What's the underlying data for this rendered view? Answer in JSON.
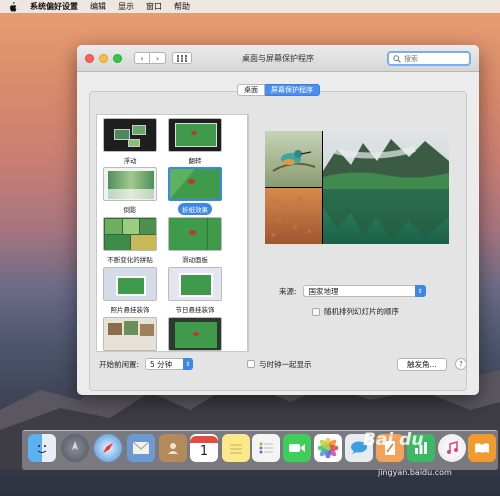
{
  "menubar": {
    "app_name": "系统偏好设置",
    "items": [
      "编辑",
      "显示",
      "窗口",
      "帮助"
    ]
  },
  "window": {
    "title": "桌面与屏幕保护程序",
    "search_placeholder": "搜索",
    "tabs": [
      {
        "label": "桌面",
        "active": false
      },
      {
        "label": "屏幕保护程序",
        "active": true
      }
    ]
  },
  "screensavers": [
    {
      "label": "浮动",
      "selected": false
    },
    {
      "label": "翻转",
      "selected": false
    },
    {
      "label": "倒影",
      "selected": false
    },
    {
      "label": "折纸效果",
      "selected": true
    },
    {
      "label": "不断变化的拼贴",
      "selected": false
    },
    {
      "label": "滑动面板",
      "selected": false
    },
    {
      "label": "照片悬挂装饰",
      "selected": false
    },
    {
      "label": "节日悬挂装饰",
      "selected": false
    },
    {
      "label": "",
      "selected": false
    },
    {
      "label": "",
      "selected": false
    }
  ],
  "options": {
    "source_label": "来源:",
    "source_value": "国家地理",
    "shuffle_label": "随机排列幻灯片的顺序",
    "shuffle_checked": false
  },
  "bottom": {
    "idle_label": "开始前闲置:",
    "idle_value": "5 分钟",
    "clock_label": "与时钟一起显示",
    "clock_checked": false,
    "hot_corners_label": "触发角...",
    "help_label": "?"
  },
  "dock": {
    "calendar_day": "1",
    "icons": [
      "finder-icon",
      "launchpad-icon",
      "safari-icon",
      "mail-icon",
      "contacts-icon",
      "calendar-icon",
      "notes-icon",
      "reminders-icon",
      "facetime-icon",
      "photos-icon",
      "messages-icon",
      "pages-icon",
      "numbers-icon",
      "itunes-icon",
      "ibooks-icon"
    ]
  },
  "watermark": {
    "logo_text": "Bai du",
    "url_text": "jingyan.baidu.com"
  }
}
